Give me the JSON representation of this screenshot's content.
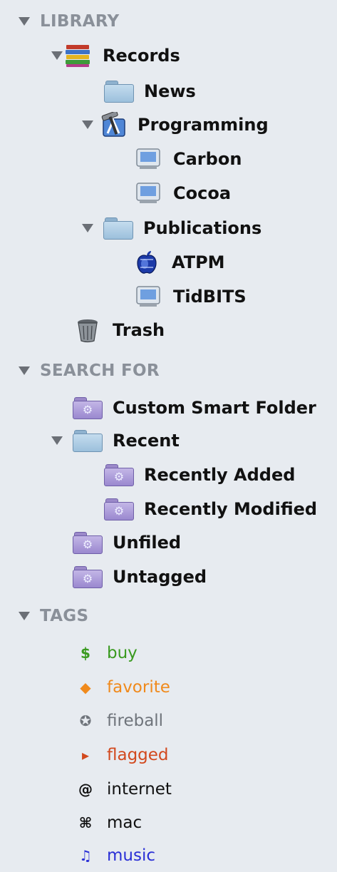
{
  "sections": {
    "library": "LIBRARY",
    "search_for": "SEARCH FOR",
    "tags": "TAGS"
  },
  "library": {
    "records": "Records",
    "news": "News",
    "programming": "Programming",
    "carbon": "Carbon",
    "cocoa": "Cocoa",
    "publications": "Publications",
    "atpm": "ATPM",
    "tidbits": "TidBITS",
    "trash": "Trash"
  },
  "search": {
    "custom_smart_folder": "Custom Smart Folder",
    "recent": "Recent",
    "recently_added": "Recently Added",
    "recently_modified": "Recently Modified",
    "unfiled": "Unfiled",
    "untagged": "Untagged"
  },
  "tags": [
    {
      "label": "buy",
      "icon": "dollar-icon",
      "glyph": "$",
      "color": "#3a9a1f"
    },
    {
      "label": "favorite",
      "icon": "diamond-icon",
      "glyph": "◆",
      "color": "#f08a1c"
    },
    {
      "label": "fireball",
      "icon": "star-circle-icon",
      "glyph": "✪",
      "color": "#6f747b"
    },
    {
      "label": "flagged",
      "icon": "triangle-right-icon",
      "glyph": "▸",
      "color": "#d2491e"
    },
    {
      "label": "internet",
      "icon": "at-icon",
      "glyph": "@",
      "color": "#111111"
    },
    {
      "label": "mac",
      "icon": "command-icon",
      "glyph": "⌘",
      "color": "#111111"
    },
    {
      "label": "music",
      "icon": "music-note-icon",
      "glyph": "♫",
      "color": "#2a2fd6"
    }
  ]
}
